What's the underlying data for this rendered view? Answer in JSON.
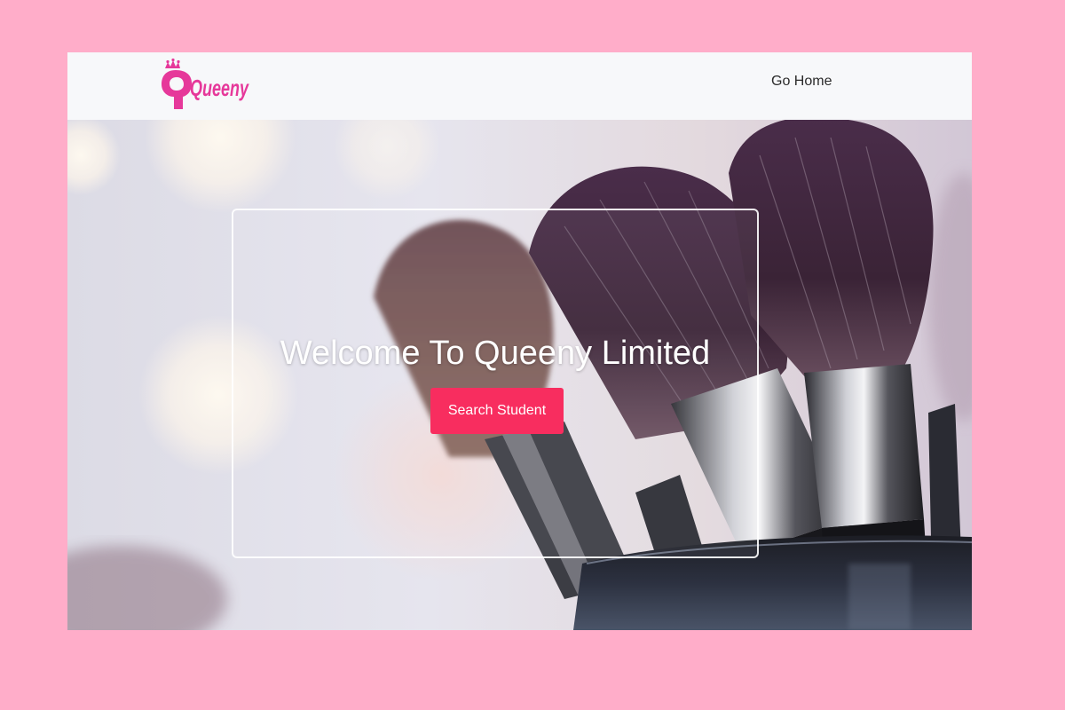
{
  "brand": {
    "logo_text": "Queeny",
    "logo_color": "#e6389a"
  },
  "nav": {
    "home_link": "Go Home"
  },
  "hero": {
    "headline": "Welcome To Queeny Limited",
    "cta_label": "Search Student",
    "cta_color": "#f82d5f",
    "background_image": "makeup-brushes-photo"
  },
  "colors": {
    "page_background": "#ffadc9",
    "navbar_background": "#f7f8fa"
  }
}
